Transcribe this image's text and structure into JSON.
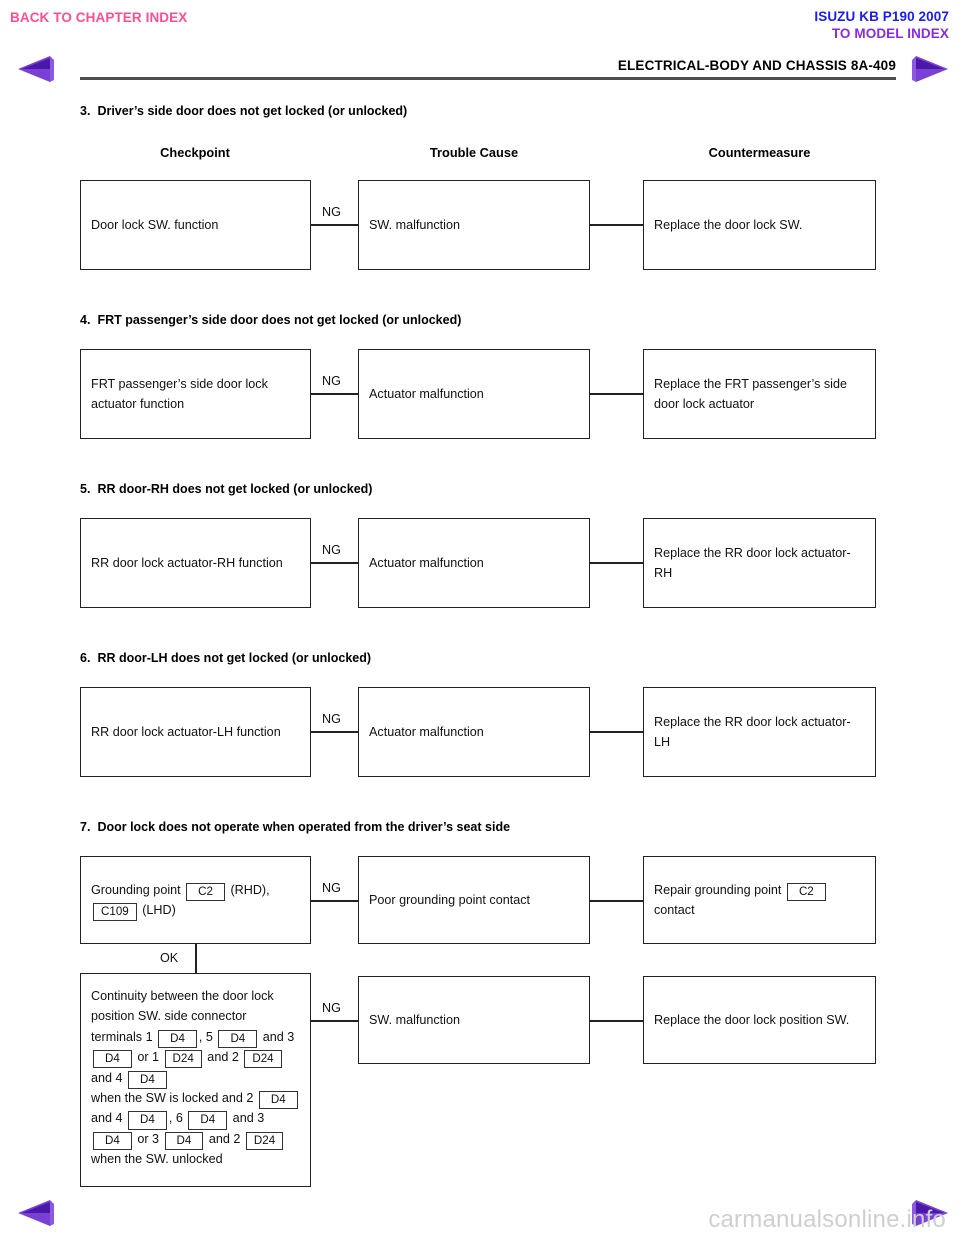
{
  "nav": {
    "back_to_chapter_index": "BACK TO CHAPTER INDEX",
    "model_name": "ISUZU KB P190 2007",
    "to_model_index": "TO MODEL INDEX",
    "prev_arrow": "prev-page-arrow",
    "next_arrow": "next-page-arrow"
  },
  "header": {
    "title": "ELECTRICAL-BODY AND CHASSIS  8A-409"
  },
  "watermark": "carmanualsonline.info",
  "columns": {
    "checkpoint": "Checkpoint",
    "trouble_cause": "Trouble Cause",
    "countermeasure": "Countermeasure"
  },
  "labels": {
    "ng": "NG",
    "ok": "OK"
  },
  "sections": [
    {
      "number": "3.",
      "title": "Driver’s side door does not get locked (or unlocked)",
      "checkpoint": "Door lock SW. function",
      "trouble_cause": "SW. malfunction",
      "countermeasure": "Replace the door lock SW."
    },
    {
      "number": "4.",
      "title": "FRT passenger’s side door does not get locked (or unlocked)",
      "checkpoint": "FRT passenger’s side door lock actuator function",
      "trouble_cause": "Actuator malfunction",
      "countermeasure": "Replace the FRT passenger’s side door lock actuator"
    },
    {
      "number": "5.",
      "title": "RR door-RH does not get locked (or unlocked)",
      "checkpoint": "RR door lock actuator-RH function",
      "trouble_cause": "Actuator malfunction",
      "countermeasure": "Replace the RR door lock actuator-RH"
    },
    {
      "number": "6.",
      "title": "RR door-LH does not get locked (or unlocked)",
      "checkpoint": "RR door lock actuator-LH function",
      "trouble_cause": "Actuator malfunction",
      "countermeasure": "Replace the RR door lock actuator-LH"
    },
    {
      "number": "7.",
      "title": "Door lock does not operate when operated from the driver’s seat side",
      "row1": {
        "checkpoint_plain": "Grounding point  C2  (RHD), C109  (LHD)",
        "checkpoint_parts": [
          {
            "t": "text",
            "v": "Grounding point "
          },
          {
            "t": "chip",
            "v": "C2"
          },
          {
            "t": "text",
            "v": " (RHD),"
          },
          {
            "t": "break"
          },
          {
            "t": "chip",
            "v": "C109"
          },
          {
            "t": "text",
            "v": " (LHD)"
          }
        ],
        "trouble_cause": "Poor grounding point contact",
        "countermeasure_parts": [
          {
            "t": "text",
            "v": "Repair grounding point "
          },
          {
            "t": "chip",
            "v": "C2"
          },
          {
            "t": "break"
          },
          {
            "t": "text",
            "v": "contact"
          }
        ]
      },
      "row2": {
        "checkpoint_plain": "Continuity between the door lock position SW. side connector terminals 1 D4 , 5 D4 and 3 D4 or 1 D24 and 2 D24 and 4 D4 when the SW is locked and 2 D4 and 4 D4 , 6 D4 and 3 D4 or 3 D4 and 2 D24 when the SW. unlocked",
        "checkpoint_parts": [
          {
            "t": "text",
            "v": "Continuity between the door lock position SW. side connector terminals 1 "
          },
          {
            "t": "chip",
            "v": "D4"
          },
          {
            "t": "text",
            "v": ", 5 "
          },
          {
            "t": "chip",
            "v": "D4"
          },
          {
            "t": "text",
            "v": " and 3 "
          },
          {
            "t": "chip",
            "v": "D4"
          },
          {
            "t": "text",
            "v": " or 1 "
          },
          {
            "t": "chip",
            "v": "D24"
          },
          {
            "t": "text",
            "v": " and 2 "
          },
          {
            "t": "chip",
            "v": "D24"
          },
          {
            "t": "text",
            "v": " and 4 "
          },
          {
            "t": "chip",
            "v": "D4"
          },
          {
            "t": "break"
          },
          {
            "t": "text",
            "v": "when the SW is locked and 2 "
          },
          {
            "t": "chip",
            "v": "D4"
          },
          {
            "t": "text",
            "v": " and 4 "
          },
          {
            "t": "chip",
            "v": "D4"
          },
          {
            "t": "text",
            "v": ", 6 "
          },
          {
            "t": "chip",
            "v": "D4"
          },
          {
            "t": "text",
            "v": " and 3 "
          },
          {
            "t": "chip",
            "v": "D4"
          },
          {
            "t": "text",
            "v": " or 3 "
          },
          {
            "t": "chip",
            "v": "D4"
          },
          {
            "t": "text",
            "v": " and 2 "
          },
          {
            "t": "chip",
            "v": "D24"
          },
          {
            "t": "text",
            "v": " when the SW. unlocked"
          }
        ],
        "trouble_cause": "SW. malfunction",
        "countermeasure": "Replace the door lock position SW."
      }
    }
  ],
  "colors": {
    "pink_link": "#ff4d94",
    "blue_link": "#1a1aff",
    "purple_link": "#8a2be2",
    "arrow_purple": "#6a30c8",
    "box_border": "#222222",
    "rule_gray": "#4d4d4d",
    "watermark_gray": "#cfcfcf"
  }
}
